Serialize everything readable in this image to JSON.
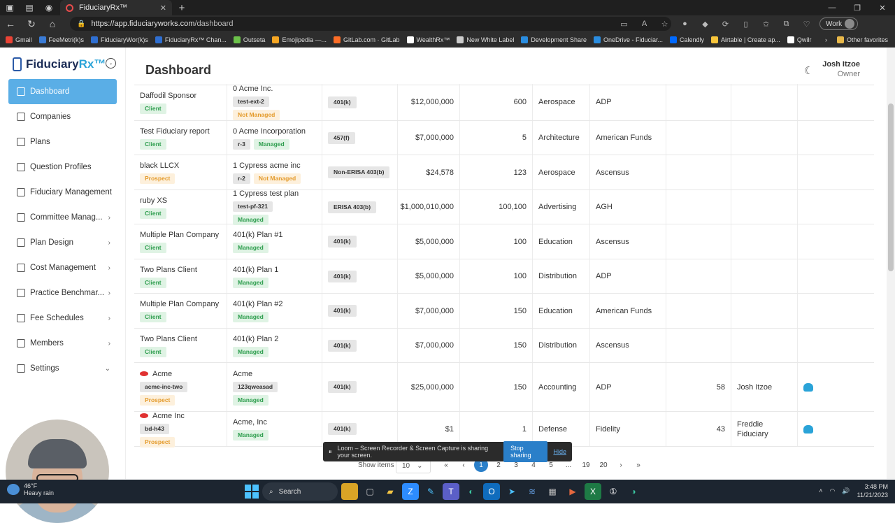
{
  "browser": {
    "tab_title": "FiduciaryRx™",
    "url_host": "https://app.fiduciaryworks.com",
    "url_path": "/dashboard",
    "profile": "Work",
    "bookmarks": [
      "Gmail",
      "FeeMetri(k)s",
      "FiduciaryWor(k)s",
      "FiduciaryRx™ Chan...",
      "Outseta",
      "Emojipedia —...",
      "GitLab.com · GitLab",
      "WealthRx™",
      "New White Label",
      "Development Share",
      "OneDrive - Fiduciar...",
      "Calendly",
      "Airtable | Create ap...",
      "Qwilr"
    ],
    "other_favorites": "Other favorites"
  },
  "app": {
    "logo_name": "Fiduciary",
    "logo_accent": "Rx™",
    "page_title": "Dashboard",
    "user_name": "Josh Itzoe",
    "user_role": "Owner"
  },
  "menu": [
    {
      "label": "Dashboard",
      "icon": "chart-icon",
      "chevron": ""
    },
    {
      "label": "Companies",
      "icon": "building-icon",
      "chevron": ""
    },
    {
      "label": "Plans",
      "icon": "bars-icon",
      "chevron": ""
    },
    {
      "label": "Question Profiles",
      "icon": "question-icon",
      "chevron": ""
    },
    {
      "label": "Fiduciary Management",
      "icon": "document-icon",
      "chevron": ""
    },
    {
      "label": "Committee Manag...",
      "icon": "briefcase-icon",
      "chevron": "›"
    },
    {
      "label": "Plan Design",
      "icon": "layout-icon",
      "chevron": "›"
    },
    {
      "label": "Cost Management",
      "icon": "wallet-icon",
      "chevron": "›"
    },
    {
      "label": "Practice Benchmar...",
      "icon": "benchmark-icon",
      "chevron": "›"
    },
    {
      "label": "Fee Schedules",
      "icon": "calendar-icon",
      "chevron": "›"
    },
    {
      "label": "Members",
      "icon": "users-icon",
      "chevron": "›"
    },
    {
      "label": "Settings",
      "icon": "gear-icon",
      "chevron": "⌄"
    }
  ],
  "rows": [
    {
      "company": "Daffodil Sponsor",
      "status": "Client",
      "plan": "0 Acme Inc.",
      "code": "test-ext-2",
      "managed": "Not Managed",
      "plan_type": "401(k)",
      "assets": "$12,000,000",
      "participants": "600",
      "industry": "Aerospace",
      "recordkeeper": "ADP",
      "score": "",
      "advisor": "",
      "download": false,
      "logo": false
    },
    {
      "company": "Test Fiduciary report",
      "status": "Client",
      "plan": "0 Acme Incorporation",
      "code": "r-3",
      "managed": "Managed",
      "plan_type": "457(f)",
      "assets": "$7,000,000",
      "participants": "5",
      "industry": "Architecture",
      "recordkeeper": "American Funds",
      "score": "",
      "advisor": "",
      "download": false,
      "logo": false
    },
    {
      "company": "black LLCX",
      "status": "Prospect",
      "plan": "1 Cypress acme inc",
      "code": "r-2",
      "managed": "Not Managed",
      "plan_type": "Non-ERISA 403(b)",
      "assets": "$24,578",
      "participants": "123",
      "industry": "Aerospace",
      "recordkeeper": "Ascensus",
      "score": "",
      "advisor": "",
      "download": false,
      "logo": false
    },
    {
      "company": "ruby XS",
      "status": "Client",
      "plan": "1 Cypress test plan",
      "code": "test-pf-321",
      "managed": "Managed",
      "plan_type": "ERISA 403(b)",
      "assets": "$1,000,010,000",
      "participants": "100,100",
      "industry": "Advertising",
      "recordkeeper": "AGH",
      "score": "",
      "advisor": "",
      "download": false,
      "logo": false
    },
    {
      "company": "Multiple Plan Company",
      "status": "Client",
      "plan": "401(k) Plan #1",
      "code": "",
      "managed": "Managed",
      "plan_type": "401(k)",
      "assets": "$5,000,000",
      "participants": "100",
      "industry": "Education",
      "recordkeeper": "Ascensus",
      "score": "",
      "advisor": "",
      "download": false,
      "logo": false
    },
    {
      "company": "Two Plans Client",
      "status": "Client",
      "plan": "401(k) Plan 1",
      "code": "",
      "managed": "Managed",
      "plan_type": "401(k)",
      "assets": "$5,000,000",
      "participants": "100",
      "industry": "Distribution",
      "recordkeeper": "ADP",
      "score": "",
      "advisor": "",
      "download": false,
      "logo": false
    },
    {
      "company": "Multiple Plan Company",
      "status": "Client",
      "plan": "401(k) Plan #2",
      "code": "",
      "managed": "Managed",
      "plan_type": "401(k)",
      "assets": "$7,000,000",
      "participants": "150",
      "industry": "Education",
      "recordkeeper": "American Funds",
      "score": "",
      "advisor": "",
      "download": false,
      "logo": false
    },
    {
      "company": "Two Plans Client",
      "status": "Client",
      "plan": "401(k) Plan 2",
      "code": "",
      "managed": "Managed",
      "plan_type": "401(k)",
      "assets": "$7,000,000",
      "participants": "150",
      "industry": "Distribution",
      "recordkeeper": "Ascensus",
      "score": "",
      "advisor": "",
      "download": false,
      "logo": false
    },
    {
      "company": "Acme",
      "company_code": "acme-inc-two",
      "status": "Prospect",
      "plan": "Acme",
      "code": "123qweasad",
      "managed": "Managed",
      "plan_type": "401(k)",
      "assets": "$25,000,000",
      "participants": "150",
      "industry": "Accounting",
      "recordkeeper": "ADP",
      "score": "58",
      "advisor": "Josh Itzoe",
      "download": true,
      "logo": true
    },
    {
      "company": "Acme Inc",
      "company_code": "bd-h43",
      "status": "Prospect",
      "plan": "Acme, Inc",
      "code": "",
      "managed": "Managed",
      "plan_type": "401(k)",
      "assets": "$1",
      "participants": "1",
      "industry": "Defense",
      "recordkeeper": "Fidelity",
      "score": "43",
      "advisor": "Freddie Fiduciary",
      "download": true,
      "logo": true
    }
  ],
  "pager": {
    "show_items_label": "Show items",
    "page_size": "10",
    "pages": [
      "«",
      "‹",
      "1",
      "2",
      "3",
      "4",
      "5",
      "...",
      "19",
      "20",
      "›",
      "»"
    ],
    "current": "1"
  },
  "loom": {
    "message": "Loom – Screen Recorder & Screen Capture is sharing your screen.",
    "stop": "Stop sharing",
    "hide": "Hide"
  },
  "taskbar": {
    "temp": "46°F",
    "weather": "Heavy rain",
    "search": "Search",
    "time": "3:48 PM",
    "date": "11/21/2023"
  }
}
